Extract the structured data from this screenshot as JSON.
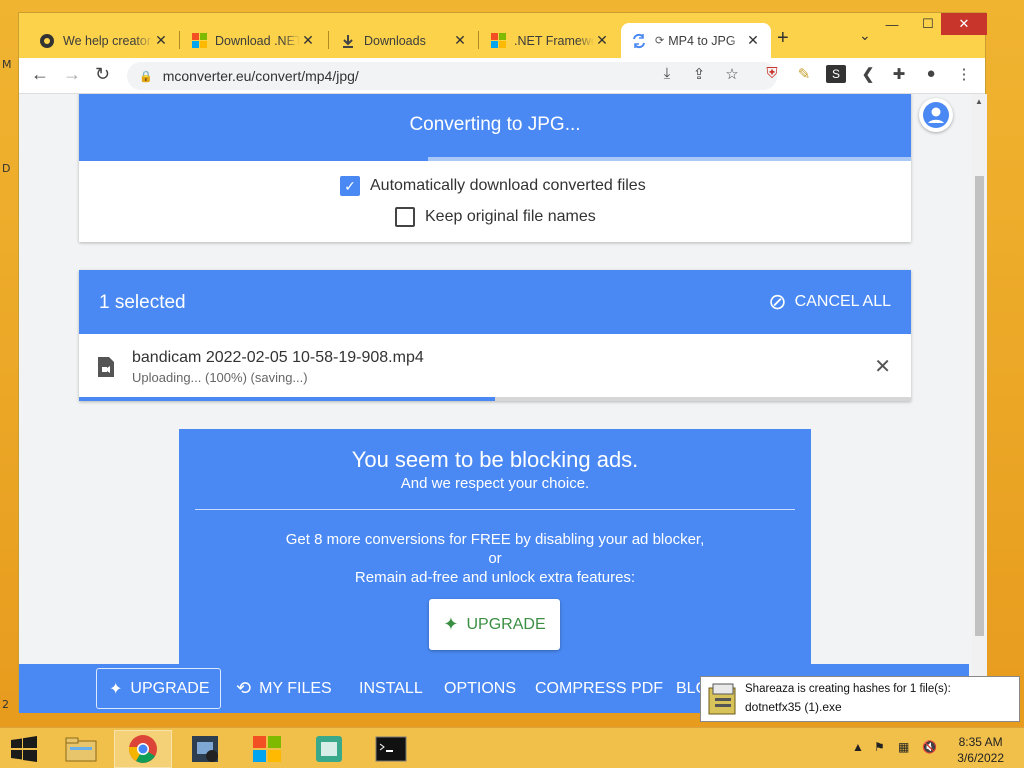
{
  "desktop": {
    "left_letters": [
      "M",
      "D",
      "2"
    ]
  },
  "browser": {
    "tabs": [
      {
        "title": "We help creators",
        "icon": "globe-icon"
      },
      {
        "title": "Download .NET",
        "icon": "microsoft-icon"
      },
      {
        "title": "Downloads",
        "icon": "download-icon"
      },
      {
        "title": ".NET Framework",
        "icon": "microsoft-icon"
      },
      {
        "title": "MP4 to JPG",
        "icon": "convert-icon",
        "active": true
      }
    ],
    "new_tab": "+",
    "url": "mconverter.eu/convert/mp4/jpg/"
  },
  "page": {
    "converting_title": "Converting to JPG...",
    "auto_download_label": "Automatically download converted files",
    "auto_download_checked": true,
    "keep_names_label": "Keep original file names",
    "keep_names_checked": false,
    "selected_count": "1 selected",
    "cancel_all": "CANCEL ALL",
    "file": {
      "name": "bandicam 2022-02-05 10-58-19-908.mp4",
      "status": "Uploading... (100%) (saving...)"
    },
    "conversion_progress_fraction": 0.42,
    "upload_progress_fraction": 0.5,
    "ad": {
      "title": "You seem to be blocking ads.",
      "subtitle": "And we respect your choice.",
      "line1": "Get 8 more conversions for FREE by disabling your ad blocker,",
      "line2": "or",
      "line3": "Remain ad-free and unlock extra features:",
      "upgrade": "UPGRADE"
    },
    "bottom_nav": [
      "UPGRADE",
      "MY FILES",
      "INSTALL",
      "OPTIONS",
      "COMPRESS PDF",
      "BLO"
    ]
  },
  "notification": {
    "line1": "Shareaza is creating hashes for 1 file(s):",
    "line2": "dotnetfx35 (1).exe"
  },
  "taskbar": {
    "time": "8:35 AM",
    "date": "3/6/2022"
  },
  "colors": {
    "accent": "#4a89f3",
    "desktop": "#e8a32a",
    "upgrade_green": "#3b8f43"
  }
}
